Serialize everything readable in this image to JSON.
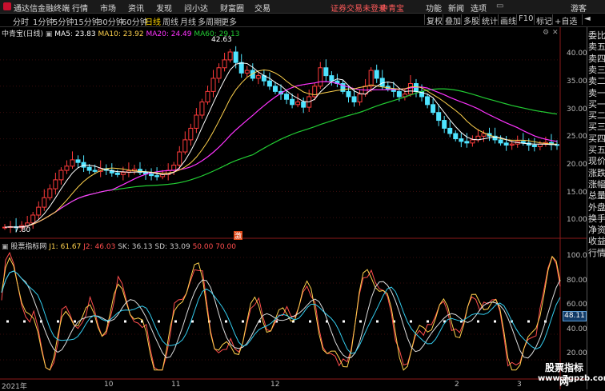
{
  "topbar": {
    "app_title": "通达信金融终端",
    "menus": [
      "行情",
      "市场",
      "资讯",
      "发现",
      "问小达",
      "财富圈",
      "交易"
    ],
    "login_notice": "证券交易未登录",
    "broker": "中青宝",
    "right_menus": [
      "功能",
      "新闻",
      "选项",
      "游客"
    ]
  },
  "toolbar": {
    "periods": [
      "分时",
      "1分钟",
      "5分钟",
      "15分钟",
      "30分钟",
      "60分钟",
      "日线",
      "周线",
      "月线",
      "多周期",
      "更多"
    ],
    "selected": "日线",
    "right_buttons": [
      "复权",
      "叠加",
      "多股",
      "统计",
      "画线",
      "F10",
      "标记",
      "+自选",
      "◄"
    ]
  },
  "main_chart": {
    "stock_label": "中青宝(日线)",
    "ma": [
      {
        "name": "MA5",
        "value": "23.83",
        "color": "#ffffff"
      },
      {
        "name": "MA10",
        "value": "23.92",
        "color": "#ffd24d"
      },
      {
        "name": "MA20",
        "value": "24.49",
        "color": "#ff33ff"
      },
      {
        "name": "MA60",
        "value": "29.13",
        "color": "#22cc33"
      }
    ],
    "high_marker": "42.63",
    "low_marker": "7.80",
    "badge": "激"
  },
  "kdj": {
    "title": "股票指标网",
    "items": [
      {
        "name": "J1",
        "value": "61.67",
        "color": "#ffd24d"
      },
      {
        "name": "J2",
        "value": "46.03",
        "color": "#ff4d4d"
      },
      {
        "name": "SK",
        "value": "36.13",
        "color": "#cccccc"
      },
      {
        "name": "SD",
        "value": "33.09",
        "color": "#cccccc"
      },
      {
        "name": "",
        "value": "50.00",
        "color": "#ff4d4d"
      },
      {
        "name": "",
        "value": "70.00",
        "color": "#ff4d4d"
      }
    ],
    "current_value": "48.11"
  },
  "y_axis_main": [
    "40.00",
    "35.00",
    "30.00",
    "25.00",
    "20.00",
    "15.00",
    "10.00"
  ],
  "y_axis_kdj": [
    "100.0",
    "80.00",
    "60.00",
    "40.00",
    "20.00"
  ],
  "x_axis": [
    "2021年",
    "10",
    "11",
    "12",
    "2",
    "3"
  ],
  "right_panel": [
    "委比",
    "卖五",
    "卖四",
    "卖三",
    "卖二",
    "卖一",
    "买一",
    "买二",
    "买三",
    "买四",
    "买五",
    "现价",
    "涨跌",
    "涨幅",
    "总量",
    "外盘",
    "换手",
    "净资",
    "收益",
    "行情"
  ],
  "watermark": {
    "line1": "股票指标网",
    "line2": "www.7gpzb.com"
  },
  "chart_data": {
    "type": "candlestick",
    "title": "中青宝(日线)",
    "ylim": [
      7,
      45
    ],
    "ohlc_close": [
      8.2,
      8.3,
      8.1,
      8.5,
      9.0,
      10.5,
      12.0,
      13.8,
      15.5,
      17.2,
      19.0,
      19.8,
      21.0,
      20.5,
      19.6,
      19.0,
      18.8,
      19.3,
      19.0,
      18.5,
      18.2,
      18.6,
      18.9,
      19.2,
      18.6,
      18.3,
      18.0,
      17.8,
      18.2,
      19.0,
      20.0,
      22.5,
      24.8,
      27.0,
      29.5,
      32.0,
      34.0,
      36.5,
      38.5,
      40.0,
      41.5,
      39.5,
      37.5,
      38.0,
      36.5,
      37.0,
      36.0,
      35.0,
      34.0,
      33.5,
      32.5,
      31.5,
      32.0,
      31.0,
      33.0,
      35.0,
      38.5,
      37.0,
      36.0,
      35.5,
      34.0,
      33.0,
      32.0,
      33.5,
      35.0,
      38.0,
      36.5,
      35.0,
      34.5,
      34.0,
      33.0,
      33.5,
      35.5,
      34.0,
      33.0,
      31.5,
      30.0,
      28.5,
      27.0,
      26.0,
      25.0,
      24.5,
      24.2,
      24.8,
      25.5,
      26.0,
      25.5,
      24.8,
      24.2,
      23.8,
      24.0,
      24.5,
      24.2,
      23.8,
      23.5,
      24.0,
      24.3,
      23.9,
      23.8
    ],
    "ma_series": [
      "MA5",
      "MA10",
      "MA20",
      "MA60"
    ],
    "kdj_levels": [
      20,
      50,
      70,
      80,
      100
    ]
  }
}
